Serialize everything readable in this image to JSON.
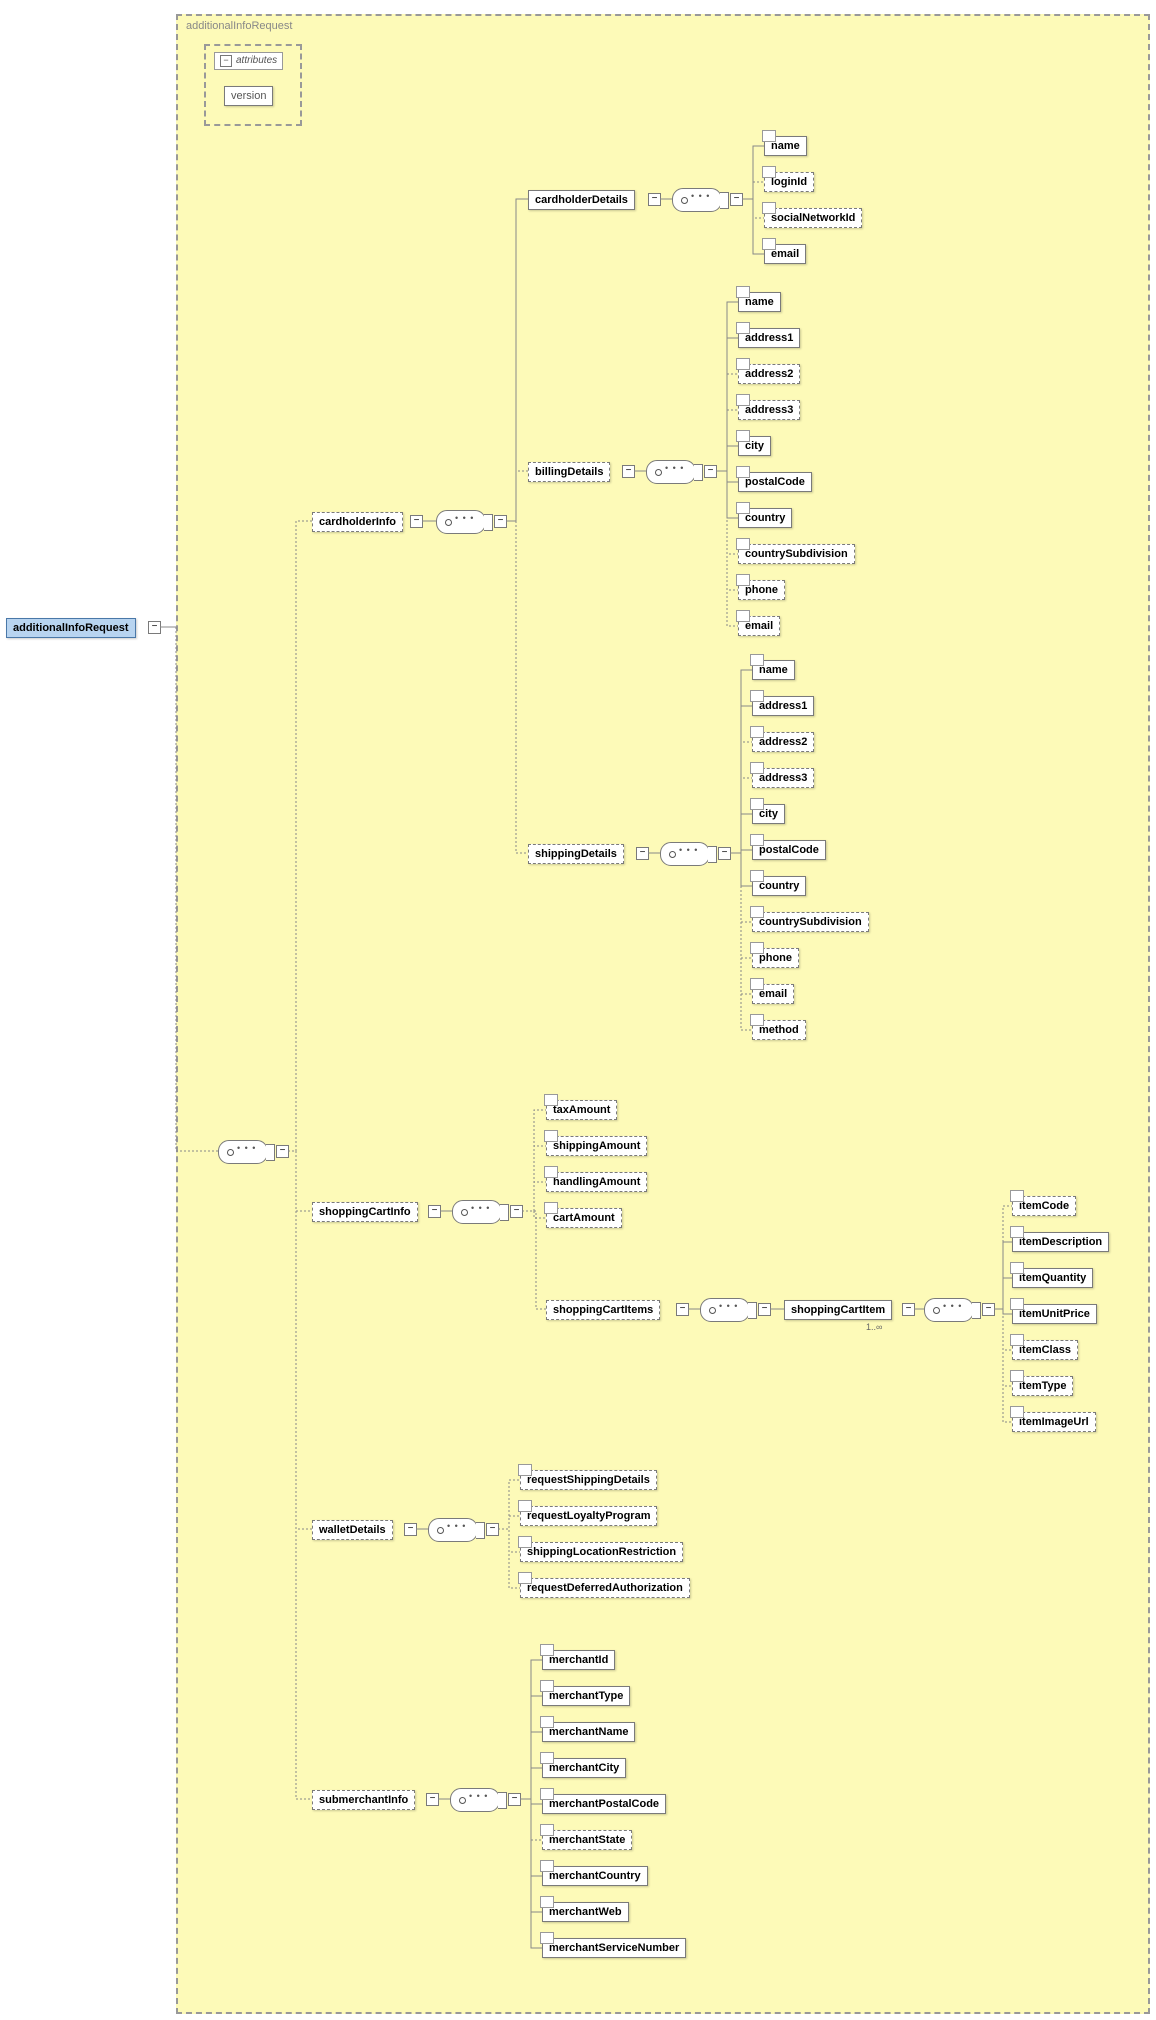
{
  "diagram": {
    "titleOuter": "additionalInfoRequest",
    "attributesLabel": "attributes",
    "versionAttr": "version",
    "cardinality": "1..∞"
  },
  "root": "additionalInfoRequest",
  "cardholderInfo": "cardholderInfo",
  "cardholderDetails": {
    "label": "cardholderDetails",
    "children": [
      "name",
      "loginId",
      "socialNetworkId",
      "email"
    ],
    "optional": [
      false,
      true,
      true,
      false
    ]
  },
  "billingDetails": {
    "label": "billingDetails",
    "children": [
      "name",
      "address1",
      "address2",
      "address3",
      "city",
      "postalCode",
      "country",
      "countrySubdivision",
      "phone",
      "email"
    ],
    "optional": [
      false,
      false,
      true,
      true,
      false,
      false,
      false,
      true,
      true,
      true
    ]
  },
  "shippingDetails": {
    "label": "shippingDetails",
    "children": [
      "name",
      "address1",
      "address2",
      "address3",
      "city",
      "postalCode",
      "country",
      "countrySubdivision",
      "phone",
      "email",
      "method"
    ],
    "optional": [
      false,
      false,
      true,
      true,
      false,
      false,
      false,
      true,
      true,
      true,
      true
    ]
  },
  "shoppingCartInfo": {
    "label": "shoppingCartInfo",
    "children": [
      "taxAmount",
      "shippingAmount",
      "handlingAmount",
      "cartAmount"
    ],
    "optional": [
      true,
      true,
      true,
      true
    ]
  },
  "shoppingCartItems": "shoppingCartItems",
  "shoppingCartItem": {
    "label": "shoppingCartItem",
    "children": [
      "itemCode",
      "itemDescription",
      "itemQuantity",
      "itemUnitPrice",
      "itemClass",
      "itemType",
      "itemImageUrl"
    ],
    "optional": [
      true,
      false,
      false,
      false,
      true,
      true,
      true
    ]
  },
  "walletDetails": {
    "label": "walletDetails",
    "children": [
      "requestShippingDetails",
      "requestLoyaltyProgram",
      "shippingLocationRestriction",
      "requestDeferredAuthorization"
    ],
    "optional": [
      true,
      true,
      true,
      true
    ]
  },
  "submerchantInfo": {
    "label": "submerchantInfo",
    "children": [
      "merchantId",
      "merchantType",
      "merchantName",
      "merchantCity",
      "merchantPostalCode",
      "merchantState",
      "merchantCountry",
      "merchantWeb",
      "merchantServiceNumber"
    ],
    "optional": [
      false,
      false,
      false,
      false,
      false,
      true,
      false,
      false,
      false
    ]
  }
}
